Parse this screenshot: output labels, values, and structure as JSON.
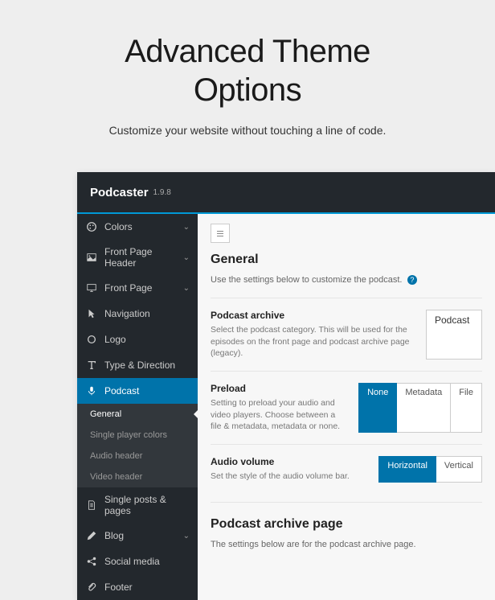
{
  "hero": {
    "title_line1": "Advanced Theme",
    "title_line2": "Options",
    "subtitle": "Customize your website without touching a line of code."
  },
  "topbar": {
    "product": "Podcaster",
    "version": "1.9.8"
  },
  "sidebar": {
    "items": [
      {
        "label": "Colors",
        "icon": "palette",
        "chev": true
      },
      {
        "label": "Front Page Header",
        "icon": "image",
        "chev": true
      },
      {
        "label": "Front Page",
        "icon": "monitor",
        "chev": true
      },
      {
        "label": "Navigation",
        "icon": "cursor"
      },
      {
        "label": "Logo",
        "icon": "circle"
      },
      {
        "label": "Type & Direction",
        "icon": "type"
      },
      {
        "label": "Podcast",
        "icon": "mic",
        "active": true
      },
      {
        "label": "Single posts & pages",
        "icon": "page"
      },
      {
        "label": "Blog",
        "icon": "pen",
        "chev": true
      },
      {
        "label": "Social media",
        "icon": "share"
      },
      {
        "label": "Footer",
        "icon": "attach"
      }
    ],
    "subitems": [
      {
        "label": "General",
        "current": true
      },
      {
        "label": "Single player colors"
      },
      {
        "label": "Audio header"
      },
      {
        "label": "Video header"
      }
    ]
  },
  "content": {
    "general": {
      "title": "General",
      "desc": "Use the settings below to customize the podcast."
    },
    "archive": {
      "title": "Podcast archive",
      "desc": "Select the podcast category. This will be used for the episodes on the front page and podcast archive page (legacy).",
      "value": "Podcast"
    },
    "preload": {
      "title": "Preload",
      "desc": "Setting to preload your audio and video players. Choose between a file & metadata, metadata or none.",
      "opts": [
        "None",
        "Metadata",
        "File"
      ],
      "selected": "None"
    },
    "volume": {
      "title": "Audio volume",
      "desc": "Set the style of the audio volume bar.",
      "opts": [
        "Horizontal",
        "Vertical"
      ],
      "selected": "Horizontal"
    },
    "archive_page": {
      "title": "Podcast archive page",
      "desc": "The settings below are for the podcast archive page."
    }
  }
}
